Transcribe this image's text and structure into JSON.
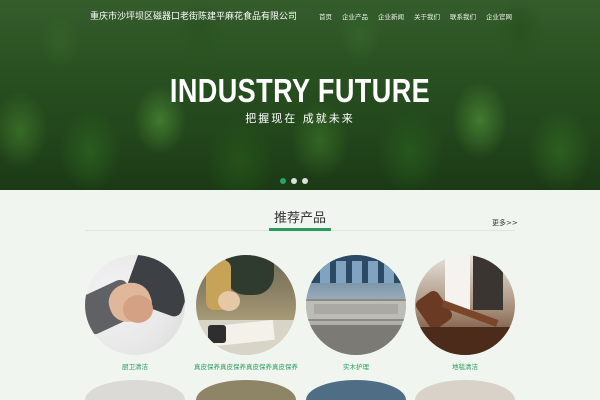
{
  "header": {
    "company_name": "重庆市沙坪坝区磁器口老街陈建平麻花食品有限公司",
    "nav": [
      "首页",
      "企业产品",
      "企业新闻",
      "关于我们",
      "联系我们",
      "企业官网"
    ]
  },
  "hero": {
    "title": "INDUSTRY FUTURE",
    "subtitle": "把握现在 成就未来",
    "slides": 3,
    "active_slide": 0
  },
  "section": {
    "title": "推荐产品",
    "more_label": "更多>>"
  },
  "products": [
    {
      "caption": "厨卫清洁",
      "icon": "handshake-image"
    },
    {
      "caption": "真皮保养真皮保养真皮保养真皮保养",
      "icon": "document-signing-image"
    },
    {
      "caption": "实木护理",
      "icon": "building-facade-image"
    },
    {
      "caption": "地毯清洁",
      "icon": "gavel-image"
    }
  ],
  "colors": {
    "accent": "#2a9a5e",
    "page_background": "#f0f6ef",
    "hero_green": "#2f5d26"
  }
}
